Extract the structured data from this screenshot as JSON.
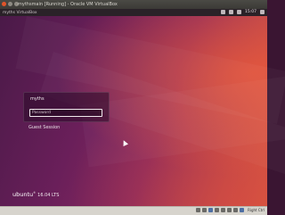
{
  "window": {
    "title": "mythsmain [Running] - Oracle VM VirtualBox"
  },
  "top_bar": {
    "name": "myths VirtualBox",
    "clock": "15:07"
  },
  "login": {
    "username": "myths",
    "password_placeholder": "Password",
    "guest_label": "Guest Session"
  },
  "branding": {
    "logo_text": "ubuntu",
    "registered": "®",
    "version": "16.04 LTS"
  },
  "statusbar": {
    "host_key": "Right Ctrl"
  }
}
